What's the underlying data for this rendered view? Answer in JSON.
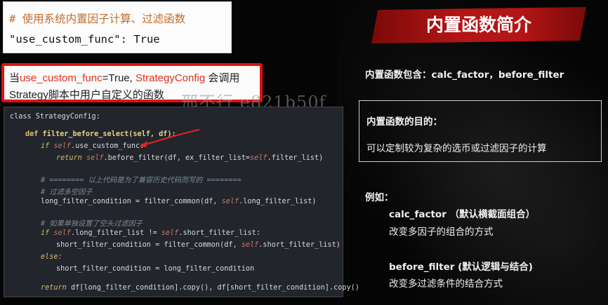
{
  "top_snippet": {
    "comment": "# 使用系统内置因子计算、过滤函数",
    "key": "\"use_custom_func\"",
    "sep": ": ",
    "value": "True"
  },
  "red_box": {
    "line1_prefix": "当",
    "line1_highlight": "use_custom_func",
    "line1_mid": "=True, ",
    "line1_highlight2": "StrategyConfig",
    "line1_suffix": " 会调用",
    "line2": "Strategy脚本中用户自定义的函数"
  },
  "watermark": "邢不行 e821b50f",
  "code": {
    "l1": "class StrategyConfig:",
    "l2_def": "def ",
    "l2_fn": "filter_before_select",
    "l2_rest": "(self, df):",
    "l3_if": "if ",
    "l3_self": "self",
    "l3_rest": ".use_custom_func:",
    "l4_ret": "return ",
    "l4_self": "self",
    "l4_rest": ".before_filter(df, ex_filter_list=",
    "l4_self2": "self",
    "l4_rest2": ".filter_list)",
    "l5": "# ======== 以上代码是为了兼容历史代码而写的 ========",
    "l6": "# 过滤多空因子",
    "l7a": "long_filter_condition = filter_common(df, ",
    "l7_self": "self",
    "l7b": ".long_filter_list)",
    "l8": "# 如果单独设置了空头过滤因子",
    "l9_if": "if ",
    "l9_self": "self",
    "l9_mid": ".long_filter_list != ",
    "l9_self2": "self",
    "l9_rest": ".short_filter_list:",
    "l10a": "short_filter_condition = filter_common(df, ",
    "l10_self": "self",
    "l10b": ".short_filter_list)",
    "l11": "else:",
    "l12": "short_filter_condition = long_filter_condition",
    "l13_ret": "return ",
    "l13_rest": "df[long_filter_condition].copy(), df[short_filter_condition].copy()"
  },
  "right": {
    "title": "内置函数简介",
    "builtin": "内置函数包含：calc_factor，before_filter",
    "purpose_title": "内置函数的目的：",
    "purpose_desc": "可以定制较为复杂的选币或过滤因子的计算",
    "eg_label": "例如：",
    "eg1_title": "calc_factor （默认横截面组合）",
    "eg1_desc": "改变多因子的组合的方式",
    "eg2_title": "before_filter (默认逻辑与结合)",
    "eg2_desc": "改变多过滤条件的结合方式"
  },
  "colors": {
    "accent_red": "#e01010",
    "banner_red": "#b41515",
    "code_bg": "#22252b"
  }
}
